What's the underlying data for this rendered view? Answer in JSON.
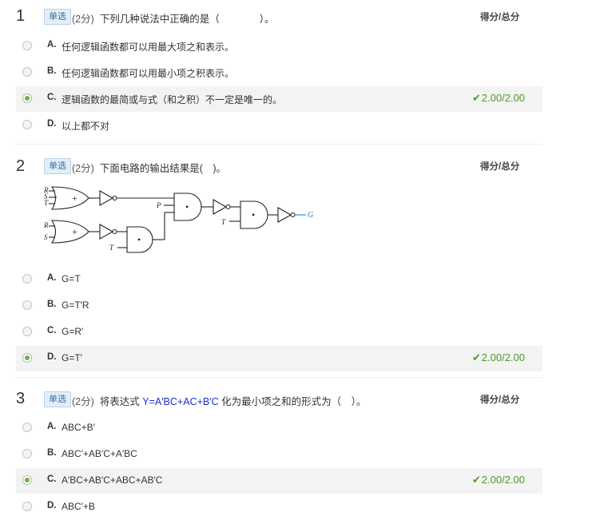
{
  "questions": [
    {
      "number": "1",
      "type": "单选",
      "points": "(2分)",
      "text": "下列几种说法中正确的是（　　　　）。",
      "score_header": "得分/总分",
      "options": [
        {
          "letter": "A.",
          "text": "任何逻辑函数都可以用最大项之和表示。"
        },
        {
          "letter": "B.",
          "text": "任何逻辑函数都可以用最小项之积表示。"
        },
        {
          "letter": "C.",
          "text": "逻辑函数的最简或与式（和之积）不一定是唯一的。"
        },
        {
          "letter": "D.",
          "text": "以上都不对"
        }
      ],
      "selected": "C",
      "score": "2.00/2.00"
    },
    {
      "number": "2",
      "type": "单选",
      "points": "(2分)",
      "text": "下面电路的输出结果是(　)。",
      "score_header": "得分/总分",
      "circuit_labels": {
        "r1": "R",
        "s1": "S",
        "t1": "T",
        "r2": "R",
        "s2": "S",
        "t2": "T",
        "p": "P",
        "t3": "T",
        "g": "G",
        "or_symbol": "+",
        "and_symbol": "•"
      },
      "options": [
        {
          "letter": "A.",
          "text": "G=T"
        },
        {
          "letter": "B.",
          "text": "G=T′R"
        },
        {
          "letter": "C.",
          "text": "G=R′"
        },
        {
          "letter": "D.",
          "text": "G=T′"
        }
      ],
      "selected": "D",
      "score": "2.00/2.00"
    },
    {
      "number": "3",
      "type": "单选",
      "points": "(2分)",
      "text_before": "将表达式",
      "formula": "Y=A′BC+AC+B′C",
      "text_after": "化为最小项之和的形式为（　）。",
      "score_header": "得分/总分",
      "options": [
        {
          "letter": "A.",
          "text": "ABC+B′"
        },
        {
          "letter": "B.",
          "text": "ABC′+AB′C+A′BC"
        },
        {
          "letter": "C.",
          "text": "A′BC+AB′C+ABC+AB′C"
        },
        {
          "letter": "D.",
          "text": "ABC′+B"
        }
      ],
      "selected": "C",
      "score": "2.00/2.00"
    }
  ],
  "colors": {
    "accent_green": "#4a9a2a",
    "radio_green": "#6db33f",
    "tag_blue": "#2f6fa8",
    "formula_blue": "#1a2fcf"
  }
}
